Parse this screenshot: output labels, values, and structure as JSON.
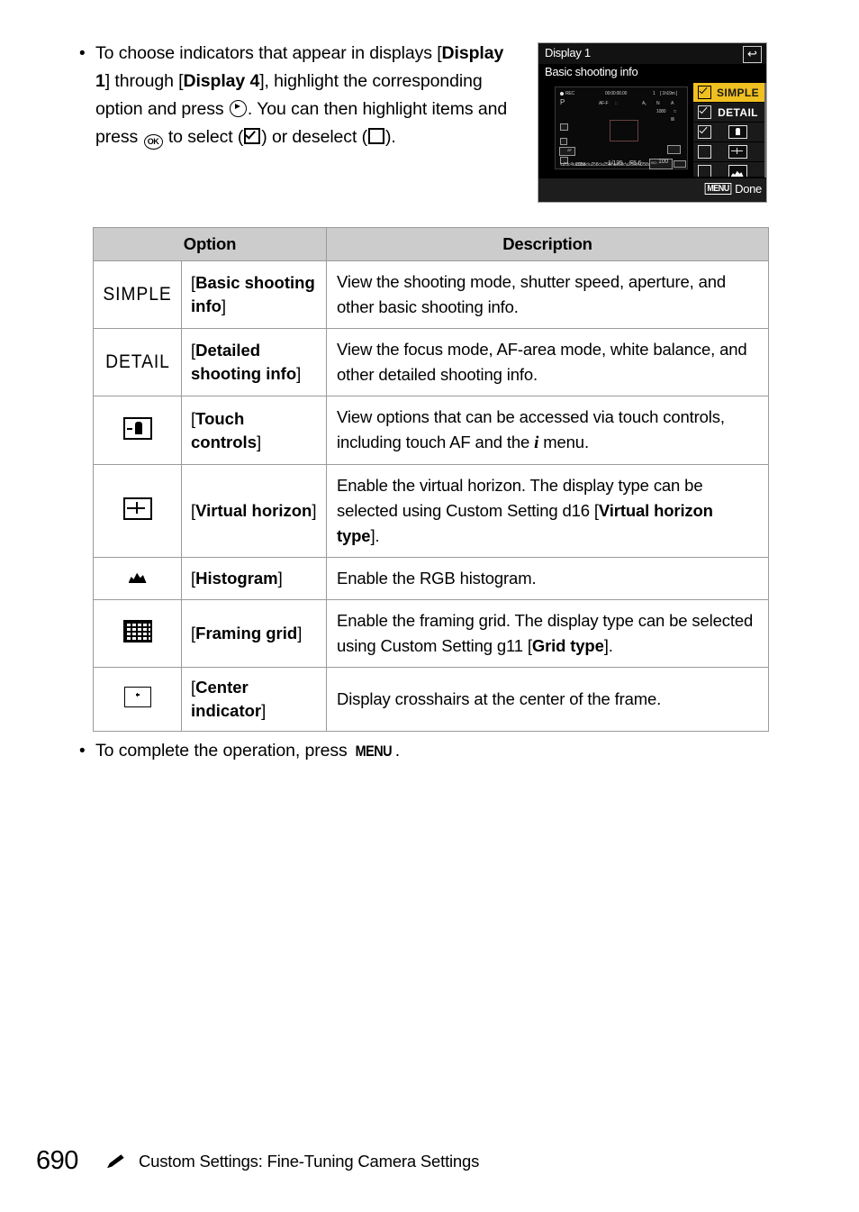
{
  "intro_bullet": {
    "bullet": "•",
    "seg1": "To choose indicators that appear in displays [",
    "b1": "Display 1",
    "seg2": "] through [",
    "b2": "Display 4",
    "seg3": "], highlight the corresponding option and press ",
    "icon_multi_selector_right": "multi-selector-right-icon",
    "seg4": ". You can then highlight items and press ",
    "icon_ok": "OK",
    "seg5": " to select (",
    "icon_checked": "checkbox-checked-icon",
    "seg6": ") or deselect (",
    "icon_unchecked": "checkbox-empty-icon",
    "seg7": ")."
  },
  "camera_screen": {
    "title": "Display 1",
    "back_icon": "↩",
    "subtitle": "Basic shooting info",
    "lcd": {
      "rec_label": "REC",
      "timecode": "00:00:00.00",
      "card_label": "1",
      "remaining": "[ 1h19m ]",
      "mode": "P",
      "focus_mode": "AF-F",
      "af_area": "∷",
      "wb": "A₁",
      "picture_control": "N",
      "image_area": "A",
      "frame_size": "1080",
      "quality": "□",
      "mic_level": "‖‖",
      "shutter": "1/125",
      "aperture": "F5.6",
      "iso": "100",
      "iso_prefix": "ISO",
      "battery": "▭",
      "touch_af": "AF"
    },
    "options": [
      {
        "label": "SIMPLE",
        "type": "text",
        "checked": true,
        "selected": true,
        "icon": ""
      },
      {
        "label": "DETAIL",
        "type": "text",
        "checked": true,
        "selected": false,
        "icon": ""
      },
      {
        "label": "",
        "type": "icon",
        "checked": true,
        "selected": false,
        "icon": "touch-controls-icon"
      },
      {
        "label": "",
        "type": "icon",
        "checked": false,
        "selected": false,
        "icon": "virtual-horizon-icon"
      },
      {
        "label": "",
        "type": "icon",
        "checked": false,
        "selected": false,
        "icon": "histogram-icon"
      },
      {
        "label": "",
        "type": "icon",
        "checked": false,
        "selected": false,
        "icon": "framing-grid-icon"
      }
    ],
    "footer": {
      "menu_key": "MENU",
      "done_label": "Done"
    }
  },
  "table": {
    "headers": [
      "Option",
      "Description"
    ],
    "rows": [
      {
        "icon_kind": "text",
        "icon_text": "SIMPLE",
        "icon_name": "simple-indicator",
        "label_parts": [
          {
            "t": "[",
            "b": false
          },
          {
            "t": "Basic shooting info",
            "b": true
          },
          {
            "t": "]",
            "b": false
          }
        ],
        "desc_parts": [
          {
            "t": "View the shooting mode, shutter speed, aperture, and other basic shooting info.",
            "b": false
          }
        ]
      },
      {
        "icon_kind": "text",
        "icon_text": "DETAIL",
        "icon_name": "detail-indicator",
        "label_parts": [
          {
            "t": "[",
            "b": false
          },
          {
            "t": "Detailed shooting info",
            "b": true
          },
          {
            "t": "]",
            "b": false
          }
        ],
        "desc_parts": [
          {
            "t": "View the focus mode, AF-area mode, white balance, and other detailed shooting info.",
            "b": false
          }
        ]
      },
      {
        "icon_kind": "touch",
        "icon_text": "",
        "icon_name": "touch-controls-icon",
        "label_parts": [
          {
            "t": "[",
            "b": false
          },
          {
            "t": "Touch controls",
            "b": true
          },
          {
            "t": "]",
            "b": false
          }
        ],
        "desc_parts": [
          {
            "t": "View options that can be accessed via touch controls, including touch AF and the ",
            "b": false
          },
          {
            "t": "i",
            "b": false,
            "i": true
          },
          {
            "t": " menu.",
            "b": false
          }
        ]
      },
      {
        "icon_kind": "vhor",
        "icon_text": "",
        "icon_name": "virtual-horizon-icon",
        "label_parts": [
          {
            "t": "[",
            "b": false
          },
          {
            "t": "Virtual horizon",
            "b": true
          },
          {
            "t": "]",
            "b": false
          }
        ],
        "desc_parts": [
          {
            "t": "Enable the virtual horizon. The display type can be selected using Custom Setting d16 [",
            "b": false
          },
          {
            "t": "Virtual horizon type",
            "b": true
          },
          {
            "t": "].",
            "b": false
          }
        ]
      },
      {
        "icon_kind": "hist",
        "icon_text": "",
        "icon_name": "histogram-icon",
        "label_parts": [
          {
            "t": "[",
            "b": false
          },
          {
            "t": "Histogram",
            "b": true
          },
          {
            "t": "]",
            "b": false
          }
        ],
        "desc_parts": [
          {
            "t": "Enable the RGB histogram.",
            "b": false
          }
        ]
      },
      {
        "icon_kind": "grid",
        "icon_text": "",
        "icon_name": "framing-grid-icon",
        "label_parts": [
          {
            "t": "[",
            "b": false
          },
          {
            "t": "Framing grid",
            "b": true
          },
          {
            "t": "]",
            "b": false
          }
        ],
        "desc_parts": [
          {
            "t": "Enable the framing grid. The display type can be selected using Custom Setting g11 [",
            "b": false
          },
          {
            "t": "Grid type",
            "b": true
          },
          {
            "t": "].",
            "b": false
          }
        ]
      },
      {
        "icon_kind": "center",
        "icon_text": "",
        "icon_name": "center-indicator-icon",
        "label_parts": [
          {
            "t": "[",
            "b": false
          },
          {
            "t": "Center indicator",
            "b": true
          },
          {
            "t": "]",
            "b": false
          }
        ],
        "desc_parts": [
          {
            "t": "Display crosshairs at the center of the frame.",
            "b": false
          }
        ]
      }
    ]
  },
  "closing_bullet": {
    "bullet": "•",
    "seg1": "To complete the operation, press ",
    "menu_key": "MENU",
    "seg2": "."
  },
  "footer": {
    "page_number": "690",
    "pencil_icon": "pencil-icon",
    "text": "Custom Settings: Fine-Tuning Camera Settings"
  },
  "colors": {
    "highlight_yellow": "#f0c020",
    "table_header_gray": "#cccccc",
    "table_border": "#9a9a9a"
  }
}
